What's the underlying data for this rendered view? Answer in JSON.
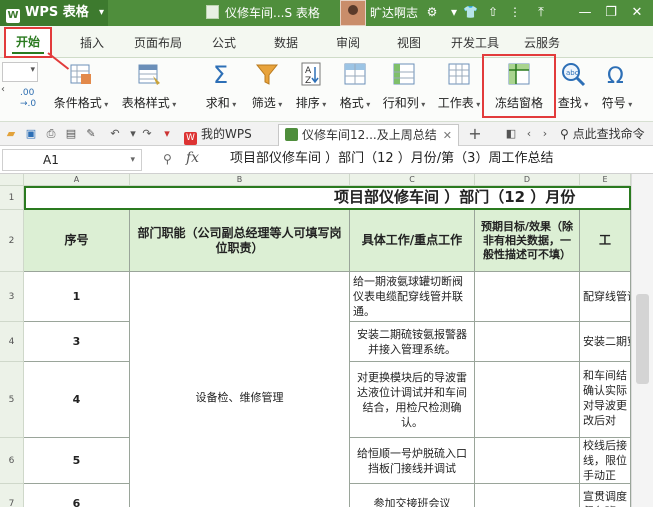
{
  "titlebar": {
    "app_name": "WPS 表格",
    "doc_title": "仪修车间...S 表格",
    "username": "旷达啊志"
  },
  "menu": {
    "tabs": [
      "开始",
      "插入",
      "页面布局",
      "公式",
      "数据",
      "审阅",
      "视图",
      "开发工具",
      "云服务"
    ]
  },
  "ribbon": {
    "conditional_format": "条件格式",
    "table_style": "表格样式",
    "sum": "求和",
    "filter": "筛选",
    "sort": "排序",
    "format": "格式",
    "row_col": "行和列",
    "worksheet": "工作表",
    "freeze_panes": "冻结窗格",
    "find": "查找",
    "symbol": "符号"
  },
  "tabs_bar": {
    "home_tab": "我的WPS",
    "doc_tab": "仪修车间12...及上周总结",
    "search_command": "点此查找命令"
  },
  "formula_bar": {
    "cell_ref": "A1",
    "fx": "fx",
    "content": "项目部仪修车间   ）部门（12  ）月份/第（3）周工作总结"
  },
  "grid": {
    "columns": [
      "A",
      "B",
      "C",
      "D",
      "E"
    ],
    "rows": [
      "1",
      "2",
      "3",
      "4",
      "5",
      "6",
      "7"
    ],
    "title": "项目部仪修车间  ）部门（12  ）月份",
    "headers": {
      "a": "序号",
      "b": "部门职能（公司副总经理等人可填写岗位职责）",
      "c": "具体工作/重点工作",
      "d": "预期目标/效果（除非有相关数据，一般性描述可不填）",
      "e": "工"
    },
    "department": "设备检、维修管理",
    "data_rows": [
      {
        "num": "1",
        "c": "给一期液氨球罐切断阀仪表电缆配穿线管并联通。",
        "e": "配穿线管调试记录"
      },
      {
        "num": "3",
        "c": "安装二期硫铵氨报警器并接入管理系统。",
        "e": "安装二期穿线管，"
      },
      {
        "num": "4",
        "c": "对更换模块后的导波雷达液位计调试并和车间结合，用检尺检测确认。",
        "e": "和车间结确认实际对导波更改后对"
      },
      {
        "num": "5",
        "c": "给恒顺一号炉脱硫入口挡板门接线并调试",
        "e": "校线后接线，限位手动正"
      },
      {
        "num": "6",
        "c": "参加交接班会议",
        "e": "宣贯调度督各班"
      }
    ]
  }
}
